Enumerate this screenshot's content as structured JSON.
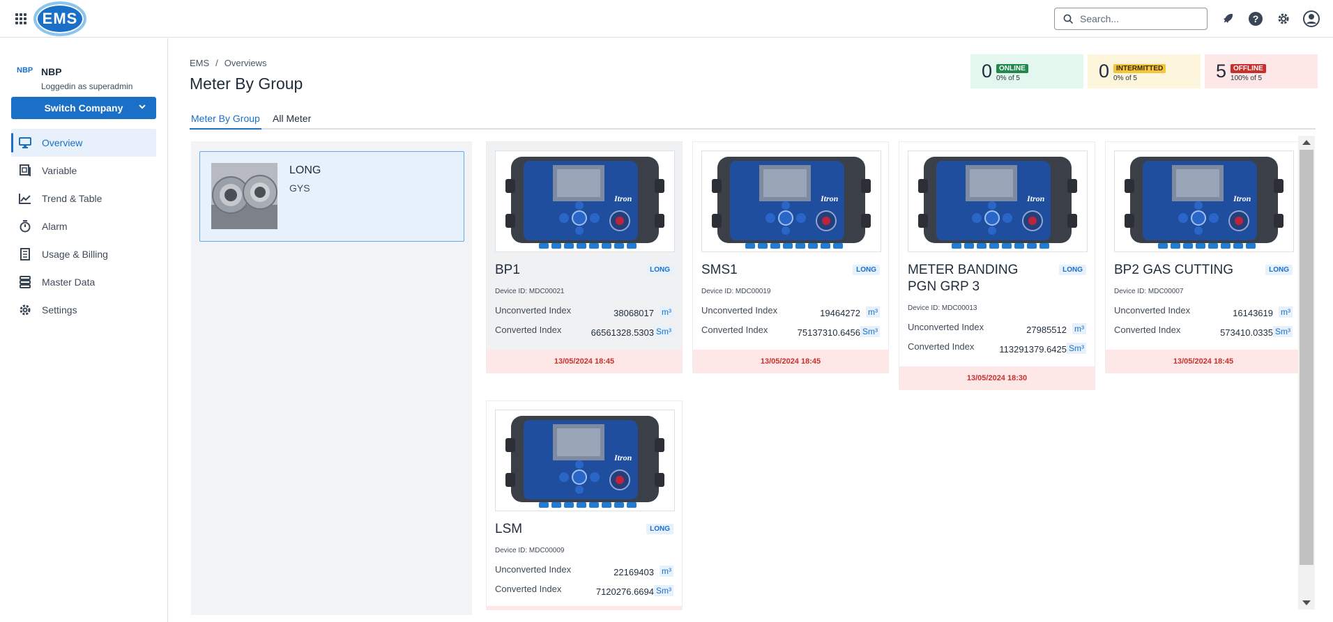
{
  "header": {
    "logo_text": "EMS",
    "search_placeholder": "Search..."
  },
  "sidebar": {
    "company_logo": "NBP",
    "company_name": "NBP",
    "logged_in_as": "Loggedin as superadmin",
    "switch_label": "Switch Company",
    "items": [
      {
        "label": "Overview",
        "icon": "monitor-icon",
        "active": true
      },
      {
        "label": "Variable",
        "icon": "variable-icon",
        "active": false
      },
      {
        "label": "Trend & Table",
        "icon": "trend-icon",
        "active": false
      },
      {
        "label": "Alarm",
        "icon": "stopwatch-icon",
        "active": false
      },
      {
        "label": "Usage & Billing",
        "icon": "billing-icon",
        "active": false
      },
      {
        "label": "Master Data",
        "icon": "database-icon",
        "active": false
      },
      {
        "label": "Settings",
        "icon": "gear-icon",
        "active": false
      }
    ]
  },
  "breadcrumb": {
    "root": "EMS",
    "sep": "/",
    "current": "Overviews"
  },
  "page_title": "Meter By Group",
  "status": {
    "online": {
      "count": "0",
      "label": "ONLINE",
      "sub": "0% of 5"
    },
    "intermitted": {
      "count": "0",
      "label": "INTERMITTED",
      "sub": "0% of 5"
    },
    "offline": {
      "count": "5",
      "label": "OFFLINE",
      "sub": "100% of 5"
    }
  },
  "tabs": [
    {
      "label": "Meter By Group",
      "active": true
    },
    {
      "label": "All Meter",
      "active": false
    }
  ],
  "group": {
    "name": "LONG",
    "sub": "GYS"
  },
  "meters": [
    {
      "name": "BP1",
      "badge": "LONG",
      "device_id": "Device ID: MDC00021",
      "unconv_label": "Unconverted Index",
      "unconv_value": "38068017",
      "unconv_unit": "m³",
      "conv_label": "Converted Index",
      "conv_value": "66561328.5303",
      "conv_unit": "Sm³",
      "timestamp": "13/05/2024 18:45"
    },
    {
      "name": "SMS1",
      "badge": "LONG",
      "device_id": "Device ID: MDC00019",
      "unconv_label": "Unconverted Index",
      "unconv_value": "19464272",
      "unconv_unit": "m³",
      "conv_label": "Converted Index",
      "conv_value": "75137310.6456",
      "conv_unit": "Sm³",
      "timestamp": "13/05/2024 18:45"
    },
    {
      "name": "METER BANDING PGN GRP 3",
      "badge": "LONG",
      "device_id": "Device ID: MDC00013",
      "unconv_label": "Unconverted Index",
      "unconv_value": "27985512",
      "unconv_unit": "m³",
      "conv_label": "Converted Index",
      "conv_value": "113291379.6425",
      "conv_unit": "Sm³",
      "timestamp": "13/05/2024 18:30"
    },
    {
      "name": "BP2 GAS CUTTING",
      "badge": "LONG",
      "device_id": "Device ID: MDC00007",
      "unconv_label": "Unconverted Index",
      "unconv_value": "16143619",
      "unconv_unit": "m³",
      "conv_label": "Converted Index",
      "conv_value": "573410.0335",
      "conv_unit": "Sm³",
      "timestamp": "13/05/2024 18:45"
    },
    {
      "name": "LSM",
      "badge": "LONG",
      "device_id": "Device ID: MDC00009",
      "unconv_label": "Unconverted Index",
      "unconv_value": "22169403",
      "unconv_unit": "m³",
      "conv_label": "Converted Index",
      "conv_value": "7120276.6694",
      "conv_unit": "Sm³",
      "timestamp": ""
    }
  ],
  "meter_brand": "Itron",
  "colors": {
    "accent": "#1a6fc7",
    "online": "#1f8a4c",
    "intermitted": "#f2c53d",
    "offline": "#c9302c"
  }
}
